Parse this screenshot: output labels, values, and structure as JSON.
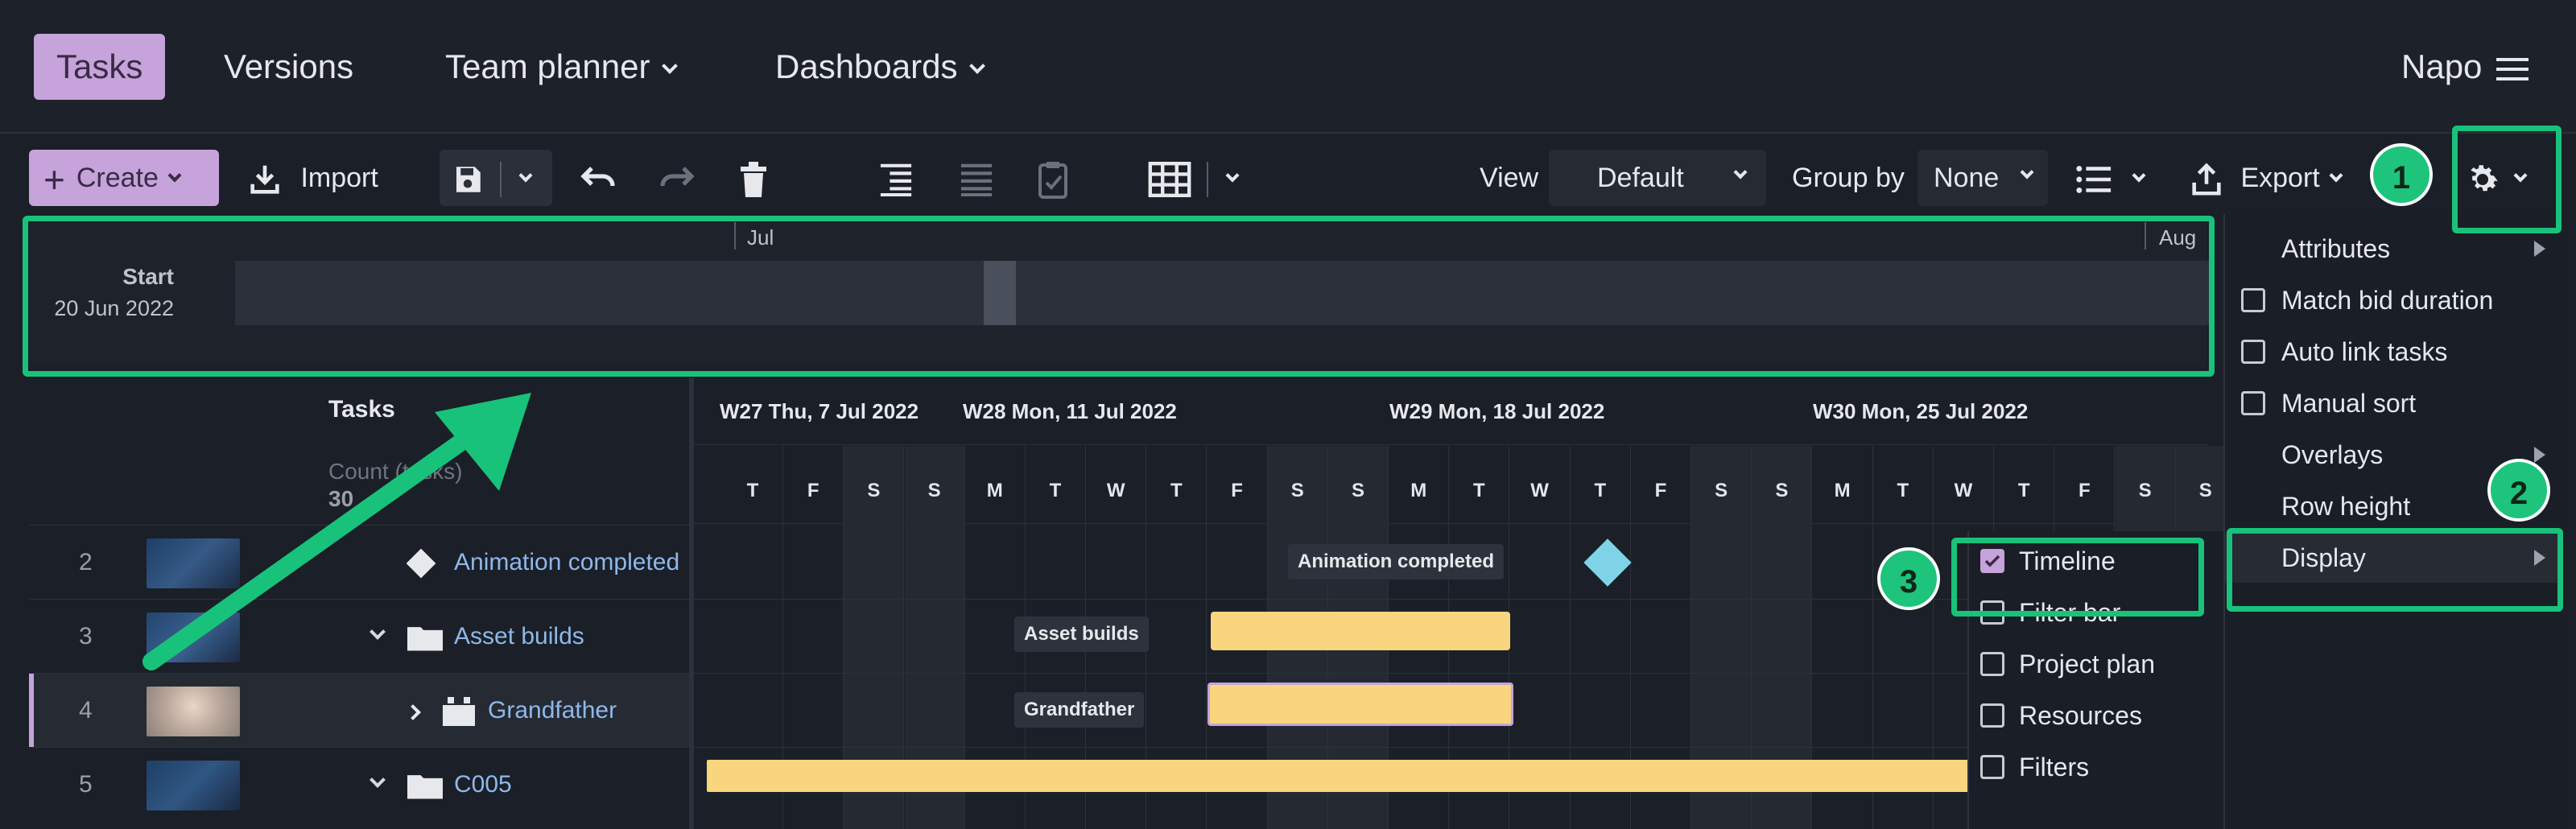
{
  "topnav": {
    "tabs": [
      "Tasks",
      "Versions",
      "Team planner",
      "Dashboards"
    ],
    "user": "Napo"
  },
  "toolbar": {
    "create_label": "Create",
    "import_label": "Import",
    "view_label": "View",
    "view_value": "Default",
    "groupby_label": "Group by",
    "groupby_value": "None",
    "export_label": "Export"
  },
  "timeline": {
    "start_label": "Start",
    "start_date": "20 Jun 2022",
    "month1": "Jul",
    "month2": "Aug"
  },
  "grid": {
    "header_tasks": "Tasks",
    "count_label": "Count (tasks)",
    "count_value": "30",
    "weeks": [
      "W27 Thu, 7 Jul 2022",
      "W28 Mon, 11 Jul 2022",
      "W29 Mon, 18 Jul 2022",
      "W30 Mon, 25 Jul 2022"
    ],
    "days": [
      "T",
      "F",
      "S",
      "S",
      "M",
      "T",
      "W",
      "T",
      "F",
      "S",
      "S",
      "M",
      "T",
      "W",
      "T",
      "F",
      "S",
      "S",
      "M",
      "T",
      "W",
      "T",
      "F",
      "S",
      "S"
    ],
    "rows": [
      {
        "num": "2",
        "name": "Animation completed"
      },
      {
        "num": "3",
        "name": "Asset builds"
      },
      {
        "num": "4",
        "name": "Grandfather"
      },
      {
        "num": "5",
        "name": "C005"
      }
    ],
    "bar_labels": {
      "animation": "Animation completed",
      "asset": "Asset builds",
      "grandfather": "Grandfather"
    }
  },
  "settings_menu": {
    "items": [
      "Attributes",
      "Match bid duration",
      "Auto link tasks",
      "Manual sort",
      "Overlays",
      "Row height",
      "Display"
    ]
  },
  "display_submenu": {
    "items": [
      "Timeline",
      "Filter bar",
      "Project plan",
      "Resources",
      "Filters"
    ],
    "checked": [
      true,
      false,
      false,
      false,
      false
    ]
  },
  "badges": [
    "1",
    "2",
    "3"
  ],
  "colors": {
    "accent": "#c6a3db",
    "annotation": "#18c27a",
    "bar": "#f8d57e",
    "milestone": "#7fd3e6"
  }
}
